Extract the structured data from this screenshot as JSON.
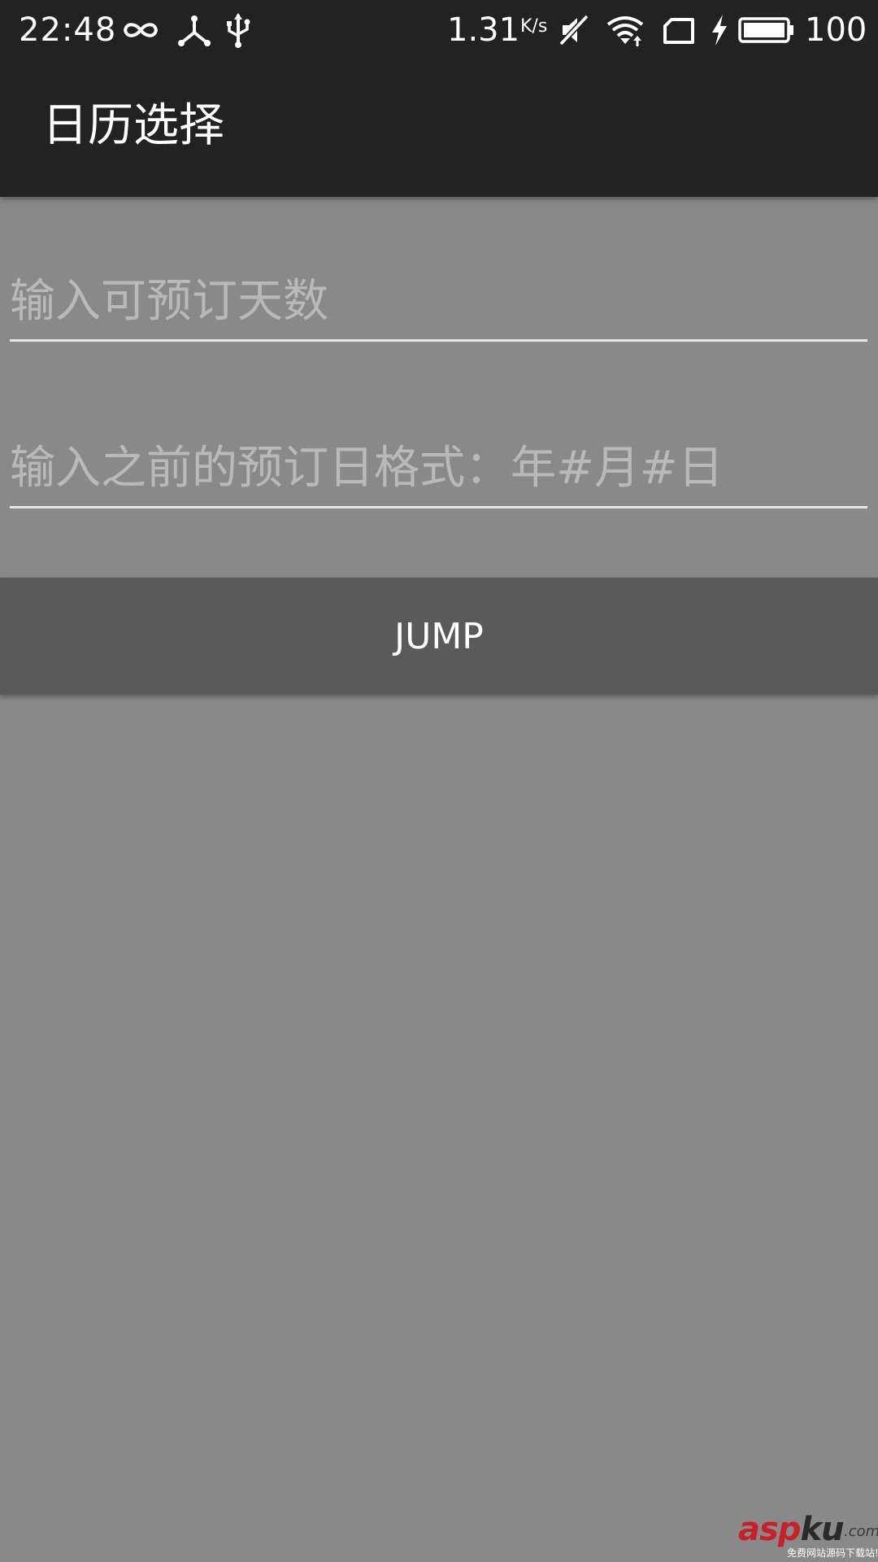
{
  "status_bar": {
    "time": "22:48",
    "left_icons": [
      "infinity-icon",
      "share-network-icon",
      "usb-icon"
    ],
    "speed_value": "1.31",
    "speed_unit": "K/s",
    "right_icons": [
      "mute-icon",
      "wifi-icon",
      "sim-card-icon",
      "charging-icon",
      "battery-icon"
    ],
    "battery_percent": "100"
  },
  "app_bar": {
    "title": "日历选择"
  },
  "form": {
    "days_input": {
      "value": "",
      "placeholder": "输入可预订天数"
    },
    "previous_date_input": {
      "value": "",
      "placeholder": "输入之前的预订日格式：年#月#日"
    },
    "jump_button_label": "JUMP"
  },
  "watermark": {
    "main_a": "asp",
    "main_b": "ku",
    "suffix": ".com",
    "tagline": "免费网站源码下载站!"
  },
  "colors": {
    "status_bar_bg": "#222222",
    "app_bar_bg": "#222222",
    "content_bg": "#898989",
    "button_bg": "#5a5a5a",
    "placeholder_text": "#b9b9b9",
    "underline": "#e6e6e6",
    "watermark_red": "#c8202a"
  }
}
